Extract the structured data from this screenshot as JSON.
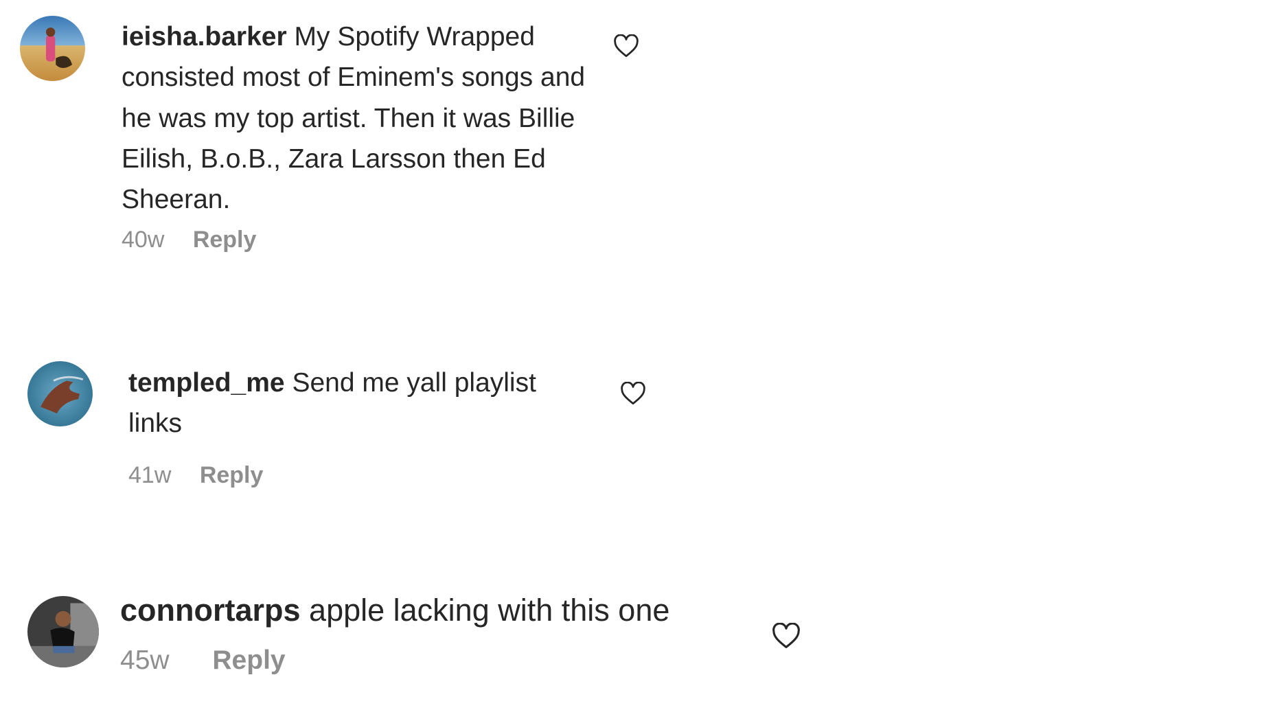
{
  "comments": [
    {
      "username": "ieisha.barker",
      "text": "My Spotify Wrapped consisted most of Eminem's songs and he was my top artist. Then it was Billie Eilish, B.o.B., Zara Larsson then Ed Sheeran.",
      "time": "40w",
      "reply_label": "Reply",
      "avatar_icon": "avatar-photo-beach",
      "like_icon": "heart-outline-icon"
    },
    {
      "username": "templed_me",
      "text": "Send me yall playlist links",
      "time": "41w",
      "reply_label": "Reply",
      "avatar_icon": "avatar-photo-hand",
      "like_icon": "heart-outline-icon"
    },
    {
      "username": "connortarps",
      "text": "apple lacking with this one",
      "time": "45w",
      "reply_label": "Reply",
      "avatar_icon": "avatar-photo-person",
      "like_icon": "heart-outline-icon"
    }
  ],
  "colors": {
    "text": "#262626",
    "meta": "#8e8e8e",
    "background": "#ffffff"
  }
}
